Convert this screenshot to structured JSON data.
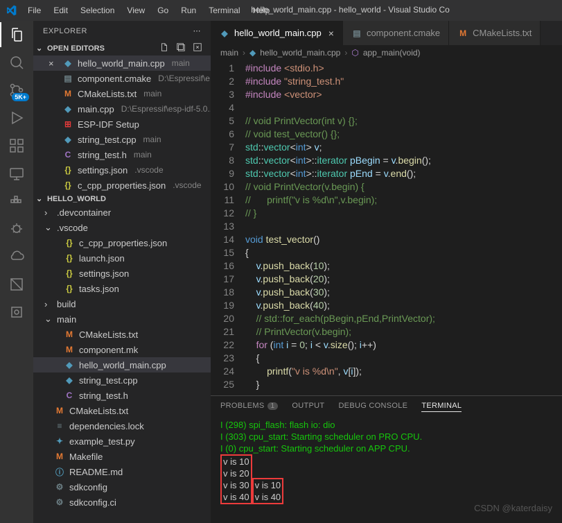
{
  "window_title": "hello_world_main.cpp - hello_world - Visual Studio Co",
  "menu": [
    "File",
    "Edit",
    "Selection",
    "View",
    "Go",
    "Run",
    "Terminal",
    "Help"
  ],
  "activity_badge": "5K+",
  "sidebar": {
    "title": "EXPLORER",
    "open_editors": {
      "label": "OPEN EDITORS",
      "items": [
        {
          "icon": "cpp",
          "name": "hello_world_main.cpp",
          "suffix": "main",
          "active": true,
          "closeable": true
        },
        {
          "icon": "cmake",
          "name": "component.cmake",
          "suffix": "D:\\Espressif\\e..."
        },
        {
          "icon": "mk",
          "name": "CMakeLists.txt",
          "suffix": "main"
        },
        {
          "icon": "cpp",
          "name": "main.cpp",
          "suffix": "D:\\Espressif\\esp-idf-5.0..."
        },
        {
          "icon": "esp",
          "name": "ESP-IDF Setup",
          "suffix": ""
        },
        {
          "icon": "cpp",
          "name": "string_test.cpp",
          "suffix": "main"
        },
        {
          "icon": "h",
          "name": "string_test.h",
          "suffix": "main"
        },
        {
          "icon": "json",
          "name": "settings.json",
          "suffix": ".vscode"
        },
        {
          "icon": "json",
          "name": "c_cpp_properties.json",
          "suffix": ".vscode"
        }
      ]
    },
    "project": {
      "label": "HELLO_WORLD",
      "tree": [
        {
          "type": "folder",
          "name": ".devcontainer",
          "expanded": false,
          "level": 0
        },
        {
          "type": "folder",
          "name": ".vscode",
          "expanded": true,
          "level": 0
        },
        {
          "type": "file",
          "icon": "json",
          "name": "c_cpp_properties.json",
          "level": 1
        },
        {
          "type": "file",
          "icon": "json",
          "name": "launch.json",
          "level": 1
        },
        {
          "type": "file",
          "icon": "json",
          "name": "settings.json",
          "level": 1
        },
        {
          "type": "file",
          "icon": "json",
          "name": "tasks.json",
          "level": 1
        },
        {
          "type": "folder",
          "name": "build",
          "expanded": false,
          "level": 0
        },
        {
          "type": "folder",
          "name": "main",
          "expanded": true,
          "level": 0
        },
        {
          "type": "file",
          "icon": "mk",
          "name": "CMakeLists.txt",
          "level": 1
        },
        {
          "type": "file",
          "icon": "mk",
          "name": "component.mk",
          "level": 1
        },
        {
          "type": "file",
          "icon": "cpp",
          "name": "hello_world_main.cpp",
          "level": 1,
          "active": true
        },
        {
          "type": "file",
          "icon": "cpp",
          "name": "string_test.cpp",
          "level": 1
        },
        {
          "type": "file",
          "icon": "h",
          "name": "string_test.h",
          "level": 1
        },
        {
          "type": "file",
          "icon": "mk",
          "name": "CMakeLists.txt",
          "level": 0
        },
        {
          "type": "file",
          "icon": "txt",
          "name": "dependencies.lock",
          "level": 0
        },
        {
          "type": "file",
          "icon": "py",
          "name": "example_test.py",
          "level": 0
        },
        {
          "type": "file",
          "icon": "mk",
          "name": "Makefile",
          "level": 0
        },
        {
          "type": "file",
          "icon": "md",
          "name": "README.md",
          "level": 0
        },
        {
          "type": "file",
          "icon": "gear",
          "name": "sdkconfig",
          "level": 0
        },
        {
          "type": "file",
          "icon": "gear",
          "name": "sdkconfig.ci",
          "level": 0
        }
      ]
    }
  },
  "tabs": [
    {
      "icon": "cpp",
      "label": "hello_world_main.cpp",
      "active": true,
      "close": true
    },
    {
      "icon": "cmake",
      "label": "component.cmake",
      "active": false
    },
    {
      "icon": "mk",
      "label": "CMakeLists.txt",
      "active": false
    }
  ],
  "breadcrumb": {
    "part1": "main",
    "part2": "hello_world_main.cpp",
    "part3": "app_main(void)"
  },
  "code_lines": 25,
  "panel": {
    "tabs": [
      {
        "label": "PROBLEMS",
        "badge": "1"
      },
      {
        "label": "OUTPUT"
      },
      {
        "label": "DEBUG CONSOLE"
      },
      {
        "label": "TERMINAL",
        "active": true
      }
    ],
    "terminal": {
      "green_lines": [
        "I (298) spi_flash: flash io: dio",
        "I (303) cpu_start: Starting scheduler on PRO CPU.",
        "I (0) cpu_start: Starting scheduler on APP CPU."
      ],
      "box1": [
        "v is 10",
        "v is 20",
        "v is 30",
        "v is 40"
      ],
      "box2": [
        "v is 10",
        "v is 40"
      ]
    }
  },
  "watermark": "CSDN @katerdaisy"
}
